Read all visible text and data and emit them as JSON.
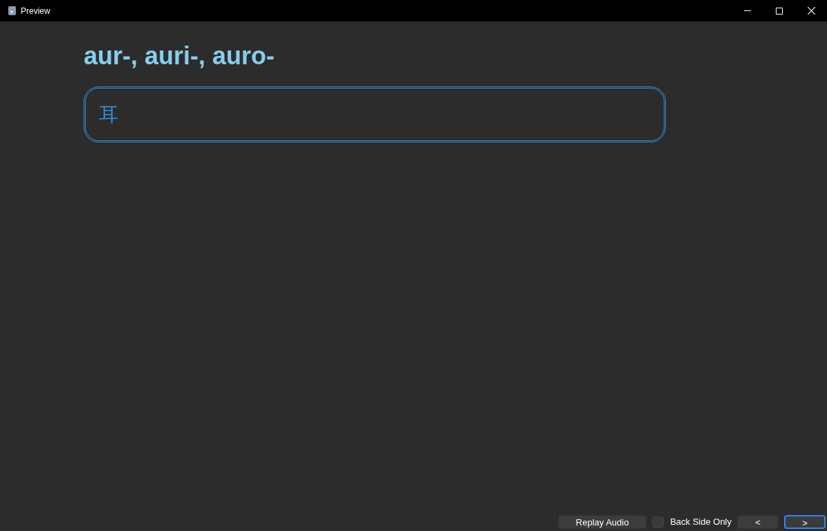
{
  "window": {
    "title": "Preview"
  },
  "heading": "aur-, auri-, auro-",
  "answer_box": {
    "text": "耳"
  },
  "controls": [
    {
      "kind": "button",
      "label": "Replay Audio",
      "focused": false
    },
    {
      "kind": "checkbox",
      "label": "Back Side Only",
      "checked": false
    },
    {
      "kind": "button",
      "label": "<",
      "focused": false
    },
    {
      "kind": "button",
      "label": ">",
      "focused": true
    }
  ]
}
